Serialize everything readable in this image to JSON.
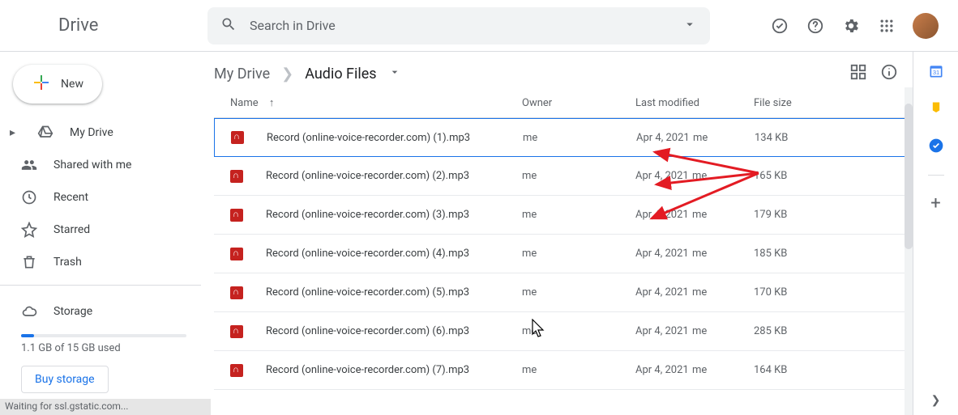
{
  "header": {
    "logo": "Drive",
    "search_placeholder": "Search in Drive"
  },
  "sidebar": {
    "new_label": "New",
    "items": [
      {
        "label": "My Drive",
        "icon": "drive"
      },
      {
        "label": "Shared with me",
        "icon": "people"
      },
      {
        "label": "Recent",
        "icon": "clock"
      },
      {
        "label": "Starred",
        "icon": "star"
      },
      {
        "label": "Trash",
        "icon": "trash"
      }
    ],
    "storage_label": "Storage",
    "storage_text": "1.1 GB of 15 GB used",
    "buy_label": "Buy storage"
  },
  "breadcrumbs": {
    "root": "My Drive",
    "current": "Audio Files"
  },
  "columns": {
    "name": "Name",
    "owner": "Owner",
    "modified": "Last modified",
    "size": "File size"
  },
  "files": [
    {
      "name": "Record (online-voice-recorder.com) (1).mp3",
      "owner": "me",
      "modified": "Apr 4, 2021",
      "modified_by": "me",
      "size": "134 KB",
      "selected": true
    },
    {
      "name": "Record (online-voice-recorder.com) (2).mp3",
      "owner": "me",
      "modified": "Apr 4, 2021",
      "modified_by": "me",
      "size": "165 KB",
      "selected": false
    },
    {
      "name": "Record (online-voice-recorder.com) (3).mp3",
      "owner": "me",
      "modified": "Apr 4, 2021",
      "modified_by": "me",
      "size": "179 KB",
      "selected": false
    },
    {
      "name": "Record (online-voice-recorder.com) (4).mp3",
      "owner": "me",
      "modified": "Apr 4, 2021",
      "modified_by": "me",
      "size": "185 KB",
      "selected": false
    },
    {
      "name": "Record (online-voice-recorder.com) (5).mp3",
      "owner": "me",
      "modified": "Apr 4, 2021",
      "modified_by": "me",
      "size": "170 KB",
      "selected": false
    },
    {
      "name": "Record (online-voice-recorder.com) (6).mp3",
      "owner": "me",
      "modified": "Apr 4, 2021",
      "modified_by": "me",
      "size": "285 KB",
      "selected": false
    },
    {
      "name": "Record (online-voice-recorder.com) (7).mp3",
      "owner": "me",
      "modified": "Apr 4, 2021",
      "modified_by": "me",
      "size": "164 KB",
      "selected": false
    }
  ],
  "status": "Waiting for ssl.gstatic.com..."
}
